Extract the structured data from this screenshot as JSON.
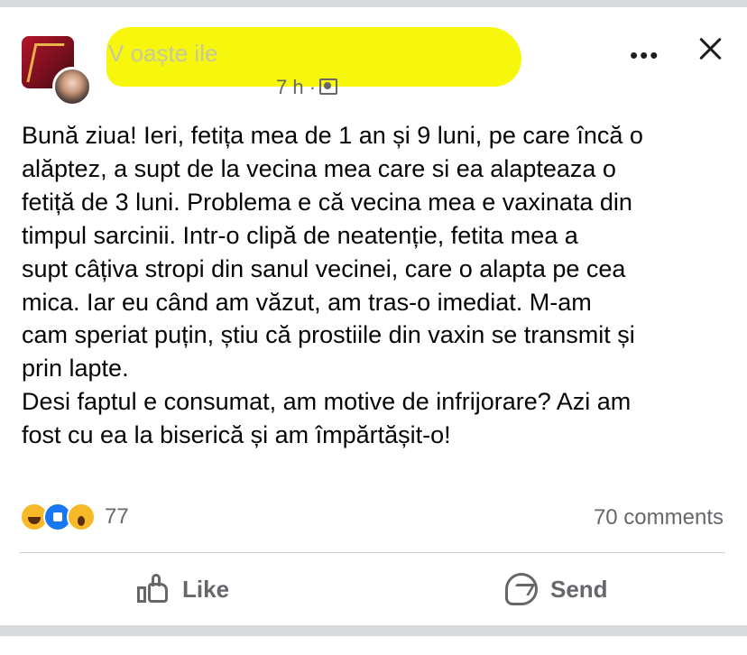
{
  "header": {
    "author_name": "V                         oaște                  ile",
    "time": "7 h ·",
    "audience_icon": "photo-icon",
    "more_label": "•••",
    "highlight_color": "#f7f500"
  },
  "post": {
    "text": "Bună ziua! Ieri, fetița mea de 1 an și 9 luni, pe care încă o\nalăptez, a supt de la vecina mea care si ea alapteaza o\nfetiță de 3 luni. Problema e că vecina mea e vaxinata din\ntimpul sarcinii. Intr-o clipă de neatenție,  fetita mea a\nsupt câțiva stropi din sanul vecinei, care o alapta pe cea\nmica. Iar eu când am văzut, am tras-o imediat. M-am\ncam speriat puțin, știu că prostiile din vaxin se transmit și\nprin lapte.\nDesi faptul e consumat, am motive de infrijorare? Azi am\nfost cu ea la biserică și am împărtășit-o!"
  },
  "stats": {
    "reactions": [
      "haha",
      "like",
      "wow"
    ],
    "reaction_count": "77",
    "comments": "70 comments"
  },
  "actions": {
    "like_label": "Like",
    "send_label": "Send"
  }
}
